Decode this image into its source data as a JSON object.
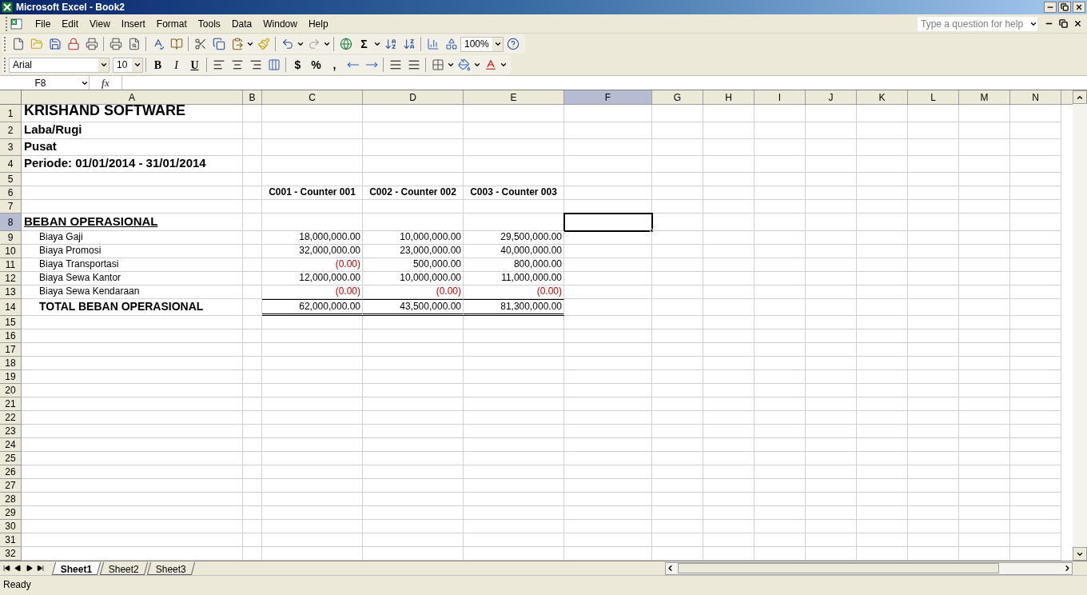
{
  "window": {
    "title": "Microsoft Excel - Book2"
  },
  "menu": [
    {
      "label": "File"
    },
    {
      "label": "Edit"
    },
    {
      "label": "View"
    },
    {
      "label": "Insert"
    },
    {
      "label": "Format"
    },
    {
      "label": "Tools"
    },
    {
      "label": "Data"
    },
    {
      "label": "Window"
    },
    {
      "label": "Help"
    }
  ],
  "help_box": {
    "placeholder": "Type a question for help"
  },
  "standard_toolbar": {
    "sum_symbol": "Σ",
    "zoom": "100%"
  },
  "formatting_toolbar": {
    "font": "Arial",
    "size": "10",
    "bold": "B",
    "italic": "I",
    "underline": "U",
    "currency": "$",
    "percent": "%",
    "comma": ","
  },
  "name_box": "F8",
  "formula_bar": {
    "label": "fx"
  },
  "columns": [
    {
      "label": "A",
      "selected": false
    },
    {
      "label": "B",
      "selected": false
    },
    {
      "label": "C",
      "selected": false
    },
    {
      "label": "D",
      "selected": false
    },
    {
      "label": "E",
      "selected": false
    },
    {
      "label": "F",
      "selected": true
    },
    {
      "label": "G",
      "selected": false
    },
    {
      "label": "H",
      "selected": false
    },
    {
      "label": "I",
      "selected": false
    },
    {
      "label": "J",
      "selected": false
    },
    {
      "label": "K",
      "selected": false
    },
    {
      "label": "L",
      "selected": false
    },
    {
      "label": "M",
      "selected": false
    },
    {
      "label": "N",
      "selected": false
    }
  ],
  "rows": [
    {
      "label": "1",
      "selected": false,
      "kind": "title",
      "text": "KRISHAND SOFTWARE"
    },
    {
      "label": "2",
      "selected": false,
      "kind": "subtitle",
      "text": "Laba/Rugi"
    },
    {
      "label": "3",
      "selected": false,
      "kind": "subtitle",
      "text": "Pusat"
    },
    {
      "label": "4",
      "selected": false,
      "kind": "subtitle",
      "text": "Periode: 01/01/2014 - 31/01/2014"
    },
    {
      "label": "5",
      "selected": false,
      "kind": "blank"
    },
    {
      "label": "6",
      "selected": false,
      "kind": "header",
      "headers": [
        "C001 - Counter 001",
        "C002 - Counter 002",
        "C003 - Counter 003"
      ]
    },
    {
      "label": "7",
      "selected": false,
      "kind": "blank"
    },
    {
      "label": "8",
      "selected": true,
      "kind": "section",
      "text": "BEBAN OPERASIONAL"
    },
    {
      "label": "9",
      "selected": false,
      "kind": "item",
      "text": "Biaya Gaji",
      "values": [
        {
          "text": "18,000,000.00",
          "negative": false
        },
        {
          "text": "10,000,000.00",
          "negative": false
        },
        {
          "text": "29,500,000.00",
          "negative": false
        }
      ]
    },
    {
      "label": "10",
      "selected": false,
      "kind": "item",
      "text": "Biaya Promosi",
      "values": [
        {
          "text": "32,000,000.00",
          "negative": false
        },
        {
          "text": "23,000,000.00",
          "negative": false
        },
        {
          "text": "40,000,000.00",
          "negative": false
        }
      ]
    },
    {
      "label": "11",
      "selected": false,
      "kind": "item",
      "text": "Biaya Transportasi",
      "values": [
        {
          "text": "(0.00)",
          "negative": true
        },
        {
          "text": "500,000.00",
          "negative": false
        },
        {
          "text": "800,000.00",
          "negative": false
        }
      ]
    },
    {
      "label": "12",
      "selected": false,
      "kind": "item",
      "text": "Biaya Sewa Kantor",
      "values": [
        {
          "text": "12,000,000.00",
          "negative": false
        },
        {
          "text": "10,000,000.00",
          "negative": false
        },
        {
          "text": "11,000,000.00",
          "negative": false
        }
      ]
    },
    {
      "label": "13",
      "selected": false,
      "kind": "item",
      "text": "Biaya Sewa Kendaraan",
      "values": [
        {
          "text": "(0.00)",
          "negative": true
        },
        {
          "text": "(0.00)",
          "negative": true
        },
        {
          "text": "(0.00)",
          "negative": true
        }
      ]
    },
    {
      "label": "14",
      "selected": false,
      "kind": "total",
      "text": "TOTAL BEBAN OPERASIONAL",
      "values": [
        {
          "text": "62,000,000.00",
          "negative": false
        },
        {
          "text": "43,500,000.00",
          "negative": false
        },
        {
          "text": "81,300,000.00",
          "negative": false
        }
      ]
    },
    {
      "label": "15",
      "selected": false,
      "kind": "blank"
    },
    {
      "label": "16",
      "selected": false,
      "kind": "blank"
    },
    {
      "label": "17",
      "selected": false,
      "kind": "blank"
    },
    {
      "label": "18",
      "selected": false,
      "kind": "blank"
    },
    {
      "label": "19",
      "selected": false,
      "kind": "blank"
    },
    {
      "label": "20",
      "selected": false,
      "kind": "blank"
    },
    {
      "label": "21",
      "selected": false,
      "kind": "blank"
    },
    {
      "label": "22",
      "selected": false,
      "kind": "blank"
    },
    {
      "label": "23",
      "selected": false,
      "kind": "blank"
    },
    {
      "label": "24",
      "selected": false,
      "kind": "blank"
    },
    {
      "label": "25",
      "selected": false,
      "kind": "blank"
    },
    {
      "label": "26",
      "selected": false,
      "kind": "blank"
    },
    {
      "label": "27",
      "selected": false,
      "kind": "blank"
    },
    {
      "label": "28",
      "selected": false,
      "kind": "blank"
    },
    {
      "label": "29",
      "selected": false,
      "kind": "blank"
    },
    {
      "label": "30",
      "selected": false,
      "kind": "blank"
    },
    {
      "label": "31",
      "selected": false,
      "kind": "blank"
    },
    {
      "label": "32",
      "selected": false,
      "kind": "blank"
    }
  ],
  "sheet_tabs": [
    {
      "label": "Sheet1",
      "selected": true
    },
    {
      "label": "Sheet2",
      "selected": false
    },
    {
      "label": "Sheet3",
      "selected": false
    }
  ],
  "status_bar": {
    "text": "Ready"
  }
}
